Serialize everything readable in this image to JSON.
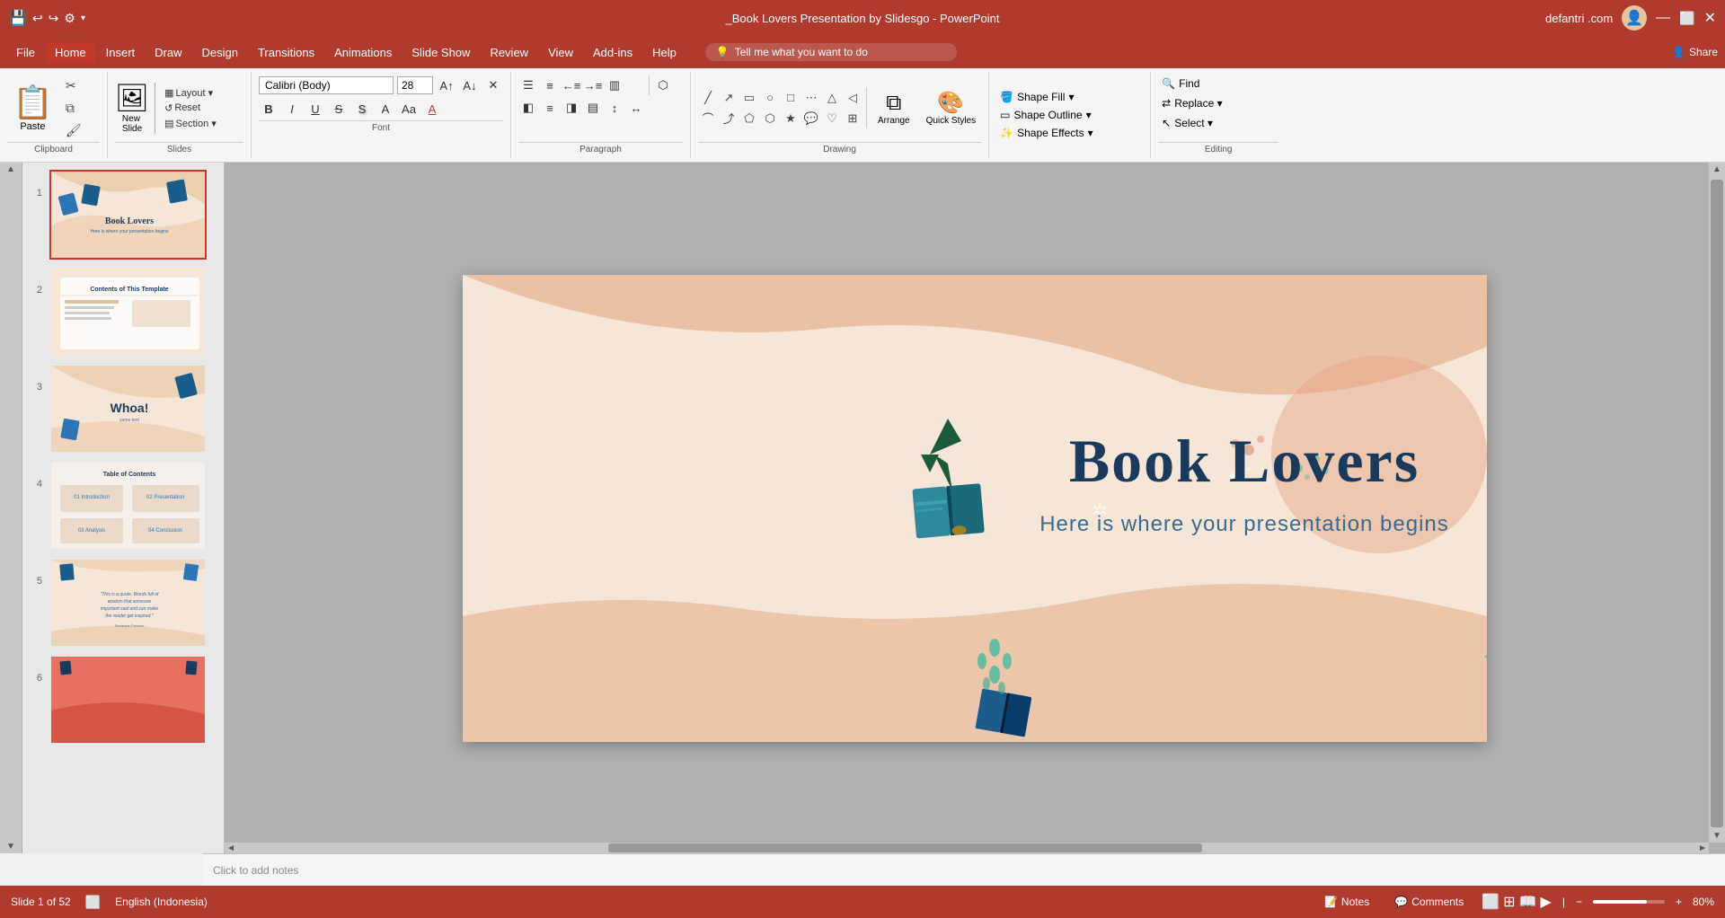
{
  "titleBar": {
    "title": "_Book Lovers Presentation by Slidesgo - PowerPoint",
    "quickSave": "💾",
    "undo": "↩",
    "redo": "↪",
    "customize": "⚙",
    "dropdown": "▾",
    "userName": "defantri .com",
    "minimize": "—",
    "restore": "⬜",
    "close": "✕"
  },
  "menuBar": {
    "items": [
      {
        "label": "File",
        "id": "file"
      },
      {
        "label": "Home",
        "id": "home",
        "active": true
      },
      {
        "label": "Insert",
        "id": "insert"
      },
      {
        "label": "Draw",
        "id": "draw"
      },
      {
        "label": "Design",
        "id": "design"
      },
      {
        "label": "Transitions",
        "id": "transitions"
      },
      {
        "label": "Animations",
        "id": "animations"
      },
      {
        "label": "Slide Show",
        "id": "slideshow"
      },
      {
        "label": "Review",
        "id": "review"
      },
      {
        "label": "View",
        "id": "view"
      },
      {
        "label": "Add-ins",
        "id": "addins"
      },
      {
        "label": "Help",
        "id": "help"
      }
    ],
    "tellMe": "Tell me what you want to do",
    "share": "Share"
  },
  "ribbon": {
    "clipboard": {
      "label": "Clipboard",
      "paste": "Paste",
      "cut": "✂",
      "copy": "⧉",
      "formatPainter": "🖌"
    },
    "slides": {
      "label": "Slides",
      "newSlide": "New Slide",
      "layout": "Layout ▾",
      "reset": "Reset",
      "section": "Section ▾"
    },
    "font": {
      "label": "Font",
      "fontName": "Calibri (Body)",
      "fontSize": "28",
      "bold": "B",
      "italic": "I",
      "underline": "U",
      "strikethrough": "S",
      "shadow": "S",
      "charSpacing": "A",
      "caseChanger": "Aa",
      "fontColor": "A",
      "clearFormatting": "✕",
      "increaseFontSize": "A↑",
      "decreaseFontSize": "A↓"
    },
    "paragraph": {
      "label": "Paragraph"
    },
    "drawing": {
      "label": "Drawing",
      "arrange": "Arrange",
      "quickStyles": "Quick Styles"
    },
    "shapeFill": "Shape Fill",
    "shapeOutline": "Shape Outline",
    "shapeEffects": "Shape Effects",
    "editing": {
      "label": "Editing",
      "find": "Find",
      "replace": "Replace ▾",
      "select": "Select ▾"
    }
  },
  "slides": [
    {
      "number": "1",
      "active": true
    },
    {
      "number": "2"
    },
    {
      "number": "3"
    },
    {
      "number": "4"
    },
    {
      "number": "5"
    },
    {
      "number": "6"
    }
  ],
  "mainSlide": {
    "title": "Book Lovers",
    "subtitle": "Here is where your presentation begins"
  },
  "statusBar": {
    "slideInfo": "Slide 1 of 52",
    "language": "English (Indonesia)",
    "notes": "Notes",
    "comments": "Comments",
    "zoom": "80%"
  },
  "notesPlaceholder": "Click to add notes",
  "icons": {
    "lightbulb": "💡",
    "search": "🔍",
    "share": "👤",
    "paste": "📋",
    "cut": "✂",
    "copy": "⧉",
    "formatPainter": "🖌",
    "newSlide": "🖼",
    "undo": "↩",
    "redo": "↪",
    "bold": "B",
    "italic": "I",
    "underline": "U",
    "notes": "📝",
    "comments": "💬"
  }
}
